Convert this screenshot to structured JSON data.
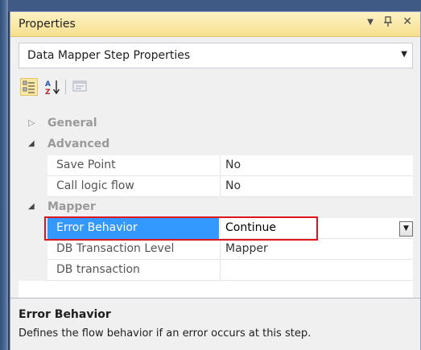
{
  "panel": {
    "title": "Properties",
    "controls": {
      "dropdown_icon": "▼",
      "pin_icon": "ꟸ",
      "close_icon": "✕"
    }
  },
  "object_selector": {
    "value": "Data Mapper Step Properties",
    "arrow_icon": "▼"
  },
  "toolbar": {
    "buttons": [
      {
        "name": "categorized-icon",
        "active": true
      },
      {
        "name": "alphabetical-icon",
        "active": false
      },
      {
        "name": "property-pages-icon",
        "active": false,
        "disabled": true
      }
    ]
  },
  "grid": {
    "categories": [
      {
        "label": "General",
        "expanded": false,
        "icon": "▷"
      },
      {
        "label": "Advanced",
        "expanded": true,
        "icon": "◢",
        "properties": [
          {
            "name": "Save Point",
            "value": "No"
          },
          {
            "name": "Call logic flow",
            "value": "No"
          }
        ]
      },
      {
        "label": "Mapper",
        "expanded": true,
        "icon": "◢",
        "properties": [
          {
            "name": "Error Behavior",
            "value": "Continue",
            "selected": true
          },
          {
            "name": "DB Transaction Level",
            "value": "Mapper"
          },
          {
            "name": "DB transaction",
            "value": ""
          }
        ]
      }
    ],
    "value_dropdown_icon": "▼"
  },
  "description": {
    "title": "Error Behavior",
    "text": "Defines the flow behavior if an error occurs at this step."
  },
  "colors": {
    "selection": "#3399ff",
    "highlight_border": "#e0161e",
    "titlebar": "#f6df8e"
  }
}
